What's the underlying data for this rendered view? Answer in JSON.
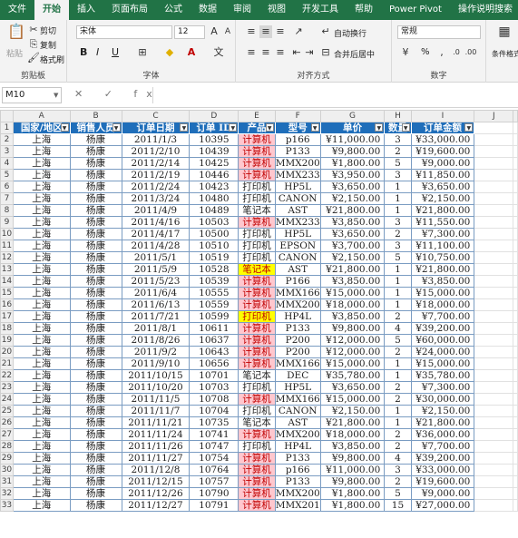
{
  "ribbon_tabs": [
    "文件",
    "开始",
    "插入",
    "页面布局",
    "公式",
    "数据",
    "审阅",
    "视图",
    "开发工具",
    "帮助",
    "Power Pivot",
    "操作说明搜索"
  ],
  "active_tab": 1,
  "clipboard": {
    "paste": "粘贴",
    "cut": "剪切",
    "copy": "复制",
    "format_painter": "格式刷",
    "label": "剪贴板"
  },
  "font": {
    "name": "宋体",
    "size": "12",
    "label": "字体",
    "bold": "B",
    "italic": "I",
    "underline": "U"
  },
  "alignment": {
    "wrap": "自动换行",
    "merge": "合并后居中",
    "label": "对齐方式"
  },
  "number": {
    "format": "常规",
    "label": "数字",
    "percent": "%"
  },
  "styles": {
    "cond_format": "条件格式"
  },
  "name_box": "M10",
  "fx_symbols": "✕ ✓ fx",
  "columns": [
    "A",
    "B",
    "C",
    "D",
    "E",
    "F",
    "G",
    "H",
    "I",
    "J"
  ],
  "headers": [
    "国家/地区",
    "销售人员",
    "订单日期",
    "订单 ID",
    "产品",
    "型号",
    "单价",
    "数量",
    "订单金额"
  ],
  "rows": [
    [
      "上海",
      "杨康",
      "2011/1/3",
      "10395",
      "计算机",
      "p166",
      "¥11,000.00",
      "3",
      "¥33,000.00"
    ],
    [
      "上海",
      "杨康",
      "2011/2/10",
      "10439",
      "计算机",
      "P133",
      "¥9,800.00",
      "2",
      "¥19,600.00"
    ],
    [
      "上海",
      "杨康",
      "2011/2/14",
      "10425",
      "计算机",
      "MMX200",
      "¥1,800.00",
      "5",
      "¥9,000.00"
    ],
    [
      "上海",
      "杨康",
      "2011/2/19",
      "10446",
      "计算机",
      "MMX233",
      "¥3,950.00",
      "3",
      "¥11,850.00"
    ],
    [
      "上海",
      "杨康",
      "2011/2/24",
      "10423",
      "打印机",
      "HP5L",
      "¥3,650.00",
      "1",
      "¥3,650.00"
    ],
    [
      "上海",
      "杨康",
      "2011/3/24",
      "10480",
      "打印机",
      "CANON",
      "¥2,150.00",
      "1",
      "¥2,150.00"
    ],
    [
      "上海",
      "杨康",
      "2011/4/9",
      "10489",
      "笔记本",
      "AST",
      "¥21,800.00",
      "1",
      "¥21,800.00"
    ],
    [
      "上海",
      "杨康",
      "2011/4/16",
      "10503",
      "计算机",
      "MMX233",
      "¥3,850.00",
      "3",
      "¥11,550.00"
    ],
    [
      "上海",
      "杨康",
      "2011/4/17",
      "10500",
      "打印机",
      "HP5L",
      "¥3,650.00",
      "2",
      "¥7,300.00"
    ],
    [
      "上海",
      "杨康",
      "2011/4/28",
      "10510",
      "打印机",
      "EPSON",
      "¥3,700.00",
      "3",
      "¥11,100.00"
    ],
    [
      "上海",
      "杨康",
      "2011/5/1",
      "10519",
      "打印机",
      "CANON",
      "¥2,150.00",
      "5",
      "¥10,750.00"
    ],
    [
      "上海",
      "杨康",
      "2011/5/9",
      "10528",
      "笔记本",
      "AST",
      "¥21,800.00",
      "1",
      "¥21,800.00"
    ],
    [
      "上海",
      "杨康",
      "2011/5/23",
      "10539",
      "计算机",
      "P166",
      "¥3,850.00",
      "1",
      "¥3,850.00"
    ],
    [
      "上海",
      "杨康",
      "2011/6/4",
      "10555",
      "计算机",
      "MMX166",
      "¥15,000.00",
      "1",
      "¥15,000.00"
    ],
    [
      "上海",
      "杨康",
      "2011/6/13",
      "10559",
      "计算机",
      "MMX200",
      "¥18,000.00",
      "1",
      "¥18,000.00"
    ],
    [
      "上海",
      "杨康",
      "2011/7/21",
      "10599",
      "打印机",
      "HP4L",
      "¥3,850.00",
      "2",
      "¥7,700.00"
    ],
    [
      "上海",
      "杨康",
      "2011/8/1",
      "10611",
      "计算机",
      "P133",
      "¥9,800.00",
      "4",
      "¥39,200.00"
    ],
    [
      "上海",
      "杨康",
      "2011/8/26",
      "10637",
      "计算机",
      "P200",
      "¥12,000.00",
      "5",
      "¥60,000.00"
    ],
    [
      "上海",
      "杨康",
      "2011/9/2",
      "10643",
      "计算机",
      "P200",
      "¥12,000.00",
      "2",
      "¥24,000.00"
    ],
    [
      "上海",
      "杨康",
      "2011/9/10",
      "10656",
      "计算机",
      "MMX166",
      "¥15,000.00",
      "1",
      "¥15,000.00"
    ],
    [
      "上海",
      "杨康",
      "2011/10/15",
      "10701",
      "笔记本",
      "DEC",
      "¥35,780.00",
      "1",
      "¥35,780.00"
    ],
    [
      "上海",
      "杨康",
      "2011/10/20",
      "10703",
      "打印机",
      "HP5L",
      "¥3,650.00",
      "2",
      "¥7,300.00"
    ],
    [
      "上海",
      "杨康",
      "2011/11/5",
      "10708",
      "计算机",
      "MMX166",
      "¥15,000.00",
      "2",
      "¥30,000.00"
    ],
    [
      "上海",
      "杨康",
      "2011/11/7",
      "10704",
      "打印机",
      "CANON",
      "¥2,150.00",
      "1",
      "¥2,150.00"
    ],
    [
      "上海",
      "杨康",
      "2011/11/21",
      "10735",
      "笔记本",
      "AST",
      "¥21,800.00",
      "1",
      "¥21,800.00"
    ],
    [
      "上海",
      "杨康",
      "2011/11/24",
      "10741",
      "计算机",
      "MMX200",
      "¥18,000.00",
      "2",
      "¥36,000.00"
    ],
    [
      "上海",
      "杨康",
      "2011/11/26",
      "10747",
      "打印机",
      "HP4L",
      "¥3,850.00",
      "2",
      "¥7,700.00"
    ],
    [
      "上海",
      "杨康",
      "2011/11/27",
      "10754",
      "计算机",
      "P133",
      "¥9,800.00",
      "4",
      "¥39,200.00"
    ],
    [
      "上海",
      "杨康",
      "2011/12/8",
      "10764",
      "计算机",
      "p166",
      "¥11,000.00",
      "3",
      "¥33,000.00"
    ],
    [
      "上海",
      "杨康",
      "2011/12/15",
      "10757",
      "计算机",
      "P133",
      "¥9,800.00",
      "2",
      "¥19,600.00"
    ],
    [
      "上海",
      "杨康",
      "2011/12/26",
      "10790",
      "计算机",
      "MMX200",
      "¥1,800.00",
      "5",
      "¥9,000.00"
    ],
    [
      "上海",
      "杨康",
      "2011/12/27",
      "10791",
      "计算机",
      "MMX201",
      "¥1,800.00",
      "15",
      "¥27,000.00"
    ]
  ],
  "highlight": {
    "pink_rows": [
      0,
      1,
      2,
      3,
      7,
      12,
      13,
      14,
      16,
      17,
      18,
      19,
      22,
      25,
      27,
      28,
      29,
      30,
      31
    ],
    "yellow_rows": [
      11,
      15
    ]
  }
}
